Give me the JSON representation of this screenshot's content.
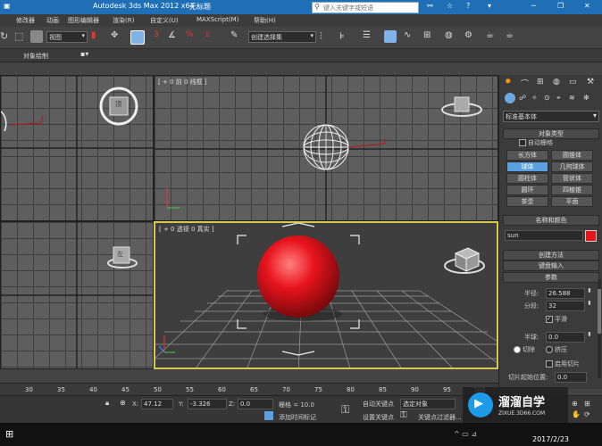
{
  "title": {
    "app": "Autodesk 3ds Max  2012 x64",
    "file": "无标题",
    "search_placeholder": "键入关键字或短语"
  },
  "menu": [
    "修改器",
    "动画",
    "图形编辑器",
    "渲染(R)",
    "自定义(U)",
    "MAXScript(M)",
    "帮助(H)"
  ],
  "toolbar": {
    "view_select": "视图",
    "selection_set": "创建选择集"
  },
  "ribbon": {
    "label": "对象绘制"
  },
  "viewports": {
    "top_center_label": "[ + 0 前 0 线框 ]",
    "perspective_label": "[ + 0 透视 0 真实 ]",
    "viewcube_top": "顶",
    "viewcube_left": "左"
  },
  "panel": {
    "category": "标准基本体",
    "object_type_title": "对象类型",
    "autogrid_label": "自动栅格",
    "buttons": [
      "长方体",
      "圆锥体",
      "球体",
      "几何球体",
      "圆柱体",
      "管状体",
      "圆环",
      "四棱锥",
      "茶壶",
      "平面"
    ],
    "name_color_title": "名称和颜色",
    "object_name": "sun",
    "object_color": "#e8141c",
    "creation_method_title": "创建方法",
    "keyboard_entry_title": "键盘输入",
    "params_title": "参数",
    "radius_label": "半径:",
    "radius_value": "26.588",
    "segments_label": "分段:",
    "segments_value": "32",
    "smooth_label": "平滑",
    "hemisphere_label": "半球:",
    "hemisphere_value": "0.0",
    "chop_label": "切除",
    "squash_label": "挤压",
    "slice_on_label": "启用切片",
    "slice_from_label": "切片起始位置:",
    "slice_from_value": "0.0"
  },
  "timeline": {
    "ticks": [
      "30",
      "35",
      "40",
      "45",
      "50",
      "55",
      "60",
      "65",
      "70",
      "75",
      "80",
      "85",
      "90",
      "95",
      "100"
    ]
  },
  "status": {
    "x_label": "X:",
    "x_value": "47.12",
    "y_label": "Y:",
    "y_value": "-3.326",
    "z_label": "Z:",
    "z_value": "0.0",
    "grid": "栅格 = 10.0",
    "add_time_tag": "添加时间标记",
    "auto_key": "自动关键点",
    "selected_object": "选定对象",
    "set_key": "设置关键点",
    "key_filter": "关键点过滤器..."
  },
  "watermark": {
    "name": "溜溜自学",
    "url": "ZIXUE.3D66.COM"
  },
  "taskbar": {
    "date": "2017/2/23"
  },
  "colors": {
    "accent": "#1e6fb5",
    "sphere": "#e8141c"
  }
}
